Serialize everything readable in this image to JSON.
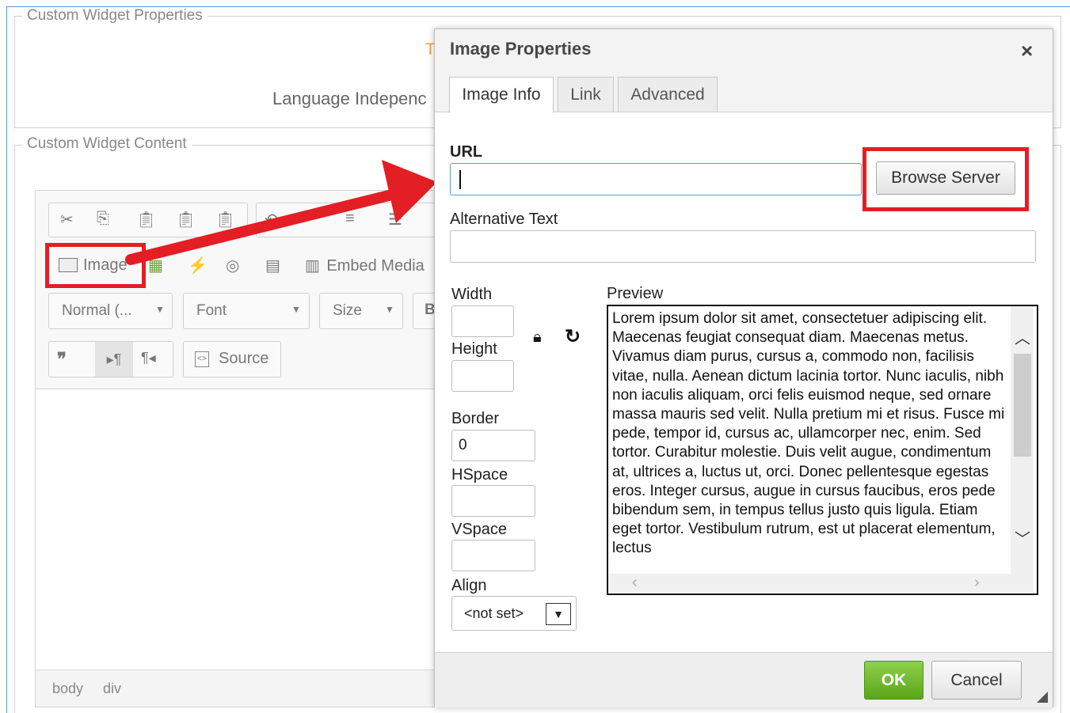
{
  "page": {
    "fieldset_properties_legend": "Custom Widget Properties",
    "fieldset_content_legend": "Custom Widget Content",
    "properties_partial_letter": "T",
    "language_label_partial": "Language Indepenc"
  },
  "editor": {
    "toolbar_row2": {
      "image_label": "Image",
      "embed_media_label": "Embed Media"
    },
    "toolbar_row3": {
      "format_combo": "Normal (...",
      "font_combo": "Font",
      "size_combo": "Size",
      "partial_button": "B"
    },
    "toolbar_row4": {
      "source_label": "Source"
    },
    "path_bar": [
      "body",
      "div"
    ]
  },
  "dialog": {
    "title": "Image Properties",
    "close_symbol": "×",
    "tabs": [
      {
        "label": "Image Info",
        "active": true
      },
      {
        "label": "Link",
        "active": false
      },
      {
        "label": "Advanced",
        "active": false
      }
    ],
    "url_label": "URL",
    "url_value": "",
    "browse_button": "Browse Server",
    "alt_label": "Alternative Text",
    "alt_value": "",
    "width_label": "Width",
    "width_value": "",
    "height_label": "Height",
    "height_value": "",
    "border_label": "Border",
    "border_value": "0",
    "hspace_label": "HSpace",
    "hspace_value": "",
    "vspace_label": "VSpace",
    "vspace_value": "",
    "align_label": "Align",
    "align_value": "<not set>",
    "preview_label": "Preview",
    "preview_text": "Lorem ipsum dolor sit amet, consectetuer adipiscing elit. Maecenas feugiat consequat diam. Maecenas metus. Vivamus diam purus, cursus a, commodo non, facilisis vitae, nulla. Aenean dictum lacinia tortor. Nunc iaculis, nibh non iaculis aliquam, orci felis euismod neque, sed ornare massa mauris sed velit. Nulla pretium mi et risus. Fusce mi pede, tempor id, cursus ac, ullamcorper nec, enim. Sed tortor. Curabitur molestie. Duis velit augue, condimentum at, ultrices a, luctus ut, orci. Donec pellentesque egestas eros. Integer cursus, augue in cursus faucibus, eros pede bibendum sem, in tempus tellus justo quis ligula. Etiam eget tortor. Vestibulum rutrum, est ut placerat elementum, lectus",
    "ok_button": "OK",
    "cancel_button": "Cancel"
  },
  "colors": {
    "highlight": "#e31e24",
    "ok_green": "#5aa51b",
    "focus_blue": "#5b9bd5"
  }
}
